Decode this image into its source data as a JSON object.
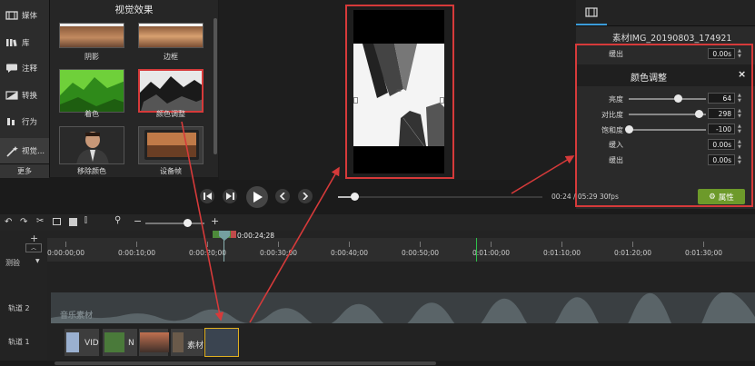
{
  "nav": {
    "items": [
      {
        "label": "媒体"
      },
      {
        "label": "库"
      },
      {
        "label": "注释"
      },
      {
        "label": "转换"
      },
      {
        "label": "行为"
      },
      {
        "label": "视觉..."
      }
    ],
    "more": "更多"
  },
  "effects": {
    "title": "视觉效果",
    "items": [
      {
        "label": "阴影"
      },
      {
        "label": "边框"
      },
      {
        "label": "着色"
      },
      {
        "label": "颜色调整"
      },
      {
        "label": "移除颜色"
      },
      {
        "label": "设备帧"
      }
    ]
  },
  "preview": {
    "handle_icon": "∞"
  },
  "right_panel": {
    "asset_title": "素材IMG_20190803_174921",
    "fade_out_top": {
      "label": "缓出",
      "value": "0.00s"
    },
    "color_adjust": {
      "title": "颜色调整",
      "close": "×",
      "brightness": {
        "label": "亮度",
        "value": "64",
        "level": 0.64
      },
      "contrast": {
        "label": "对比度",
        "value": "298",
        "level": 0.9
      },
      "saturation": {
        "label": "饱和度",
        "value": "-100",
        "level": 0.0
      },
      "fade_in": {
        "label": "缓入",
        "value": "0.00s"
      },
      "fade_out": {
        "label": "缓出",
        "value": "0.00s"
      }
    },
    "properties_button": "属性"
  },
  "transport": {
    "time": "00:24 / 05:29",
    "fps": "30fps",
    "progress": 0.08
  },
  "timeline": {
    "playhead_time": "0:00:24;28",
    "zoom_level": 0.7,
    "ticks": [
      "0:00:00;00",
      "0:00:10;00",
      "0:00:20;00",
      "0:00:30;00",
      "0:00:40;00",
      "0:00:50;00",
      "0:01:00;00",
      "0:01:10;00",
      "0:01:20;00",
      "0:01:30;00"
    ],
    "track_menu": "测验",
    "tracks": [
      {
        "label": "轨道 2",
        "clip": "音乐素材"
      },
      {
        "label": "轨道 1"
      }
    ],
    "clips": [
      {
        "label": "VID"
      },
      {
        "label": "N"
      },
      {
        "label": ""
      },
      {
        "label": "素材"
      },
      {
        "label": ""
      }
    ]
  }
}
